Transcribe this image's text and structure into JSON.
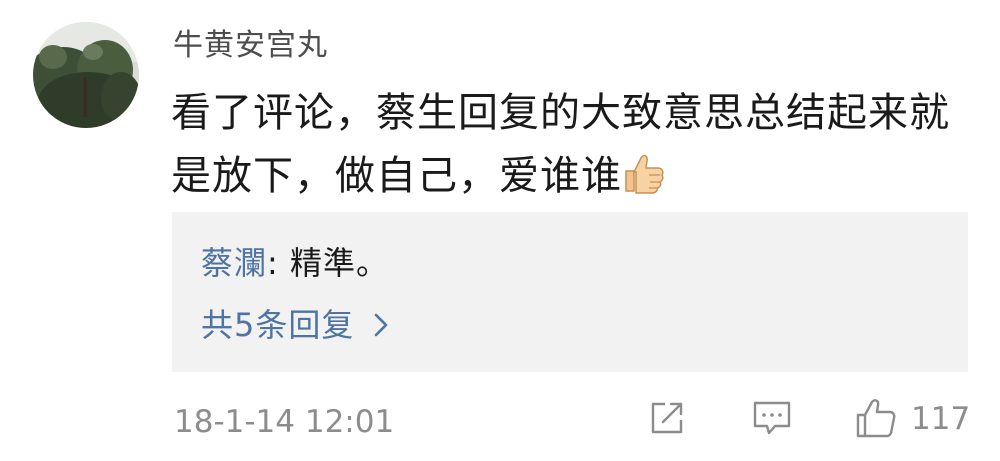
{
  "post": {
    "username": "牛黄安宫丸",
    "comment_text": "看了评论，蔡生回复的大致意思总结起来就是放下，做自己，爱谁谁",
    "comment_emoji": "thumbs-up-icon",
    "timestamp": "18-1-14 12:01",
    "like_count": "117"
  },
  "reply": {
    "author": "蔡瀾",
    "separator": ": ",
    "text": "精準。",
    "more_label": "共5条回复"
  },
  "actions": {
    "share_icon": "share-icon",
    "comment_icon": "comment-icon",
    "like_icon": "like-icon"
  },
  "colors": {
    "link_blue": "#4e74a3",
    "meta_gray": "#8c8c8c",
    "reply_bg": "#f2f2f2"
  }
}
